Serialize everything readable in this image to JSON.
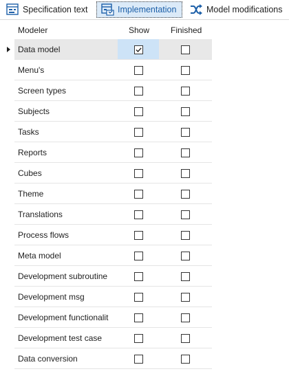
{
  "tabs": [
    {
      "label": "Specification text",
      "icon": "spec-text-icon",
      "active": false
    },
    {
      "label": "Implementation",
      "icon": "implementation-icon",
      "active": true
    },
    {
      "label": "Model modifications",
      "icon": "shuffle-icon",
      "active": false
    }
  ],
  "columns": {
    "modeler": "Modeler",
    "show": "Show",
    "finished": "Finished"
  },
  "colors": {
    "accent": "#1c5fa8",
    "selected_cell": "#cde3f7",
    "selected_row": "#e8e8e8"
  },
  "rows": [
    {
      "name": "Data model",
      "show": true,
      "finished": false,
      "selected": true
    },
    {
      "name": "Menu's",
      "show": false,
      "finished": false,
      "selected": false
    },
    {
      "name": "Screen types",
      "show": false,
      "finished": false,
      "selected": false
    },
    {
      "name": "Subjects",
      "show": false,
      "finished": false,
      "selected": false
    },
    {
      "name": "Tasks",
      "show": false,
      "finished": false,
      "selected": false
    },
    {
      "name": "Reports",
      "show": false,
      "finished": false,
      "selected": false
    },
    {
      "name": "Cubes",
      "show": false,
      "finished": false,
      "selected": false
    },
    {
      "name": "Theme",
      "show": false,
      "finished": false,
      "selected": false
    },
    {
      "name": "Translations",
      "show": false,
      "finished": false,
      "selected": false
    },
    {
      "name": "Process flows",
      "show": false,
      "finished": false,
      "selected": false
    },
    {
      "name": "Meta model",
      "show": false,
      "finished": false,
      "selected": false
    },
    {
      "name": "Development subroutine",
      "show": false,
      "finished": false,
      "selected": false
    },
    {
      "name": "Development msg",
      "show": false,
      "finished": false,
      "selected": false
    },
    {
      "name": "Development functionalit",
      "show": false,
      "finished": false,
      "selected": false
    },
    {
      "name": "Development test case",
      "show": false,
      "finished": false,
      "selected": false
    },
    {
      "name": "Data conversion",
      "show": false,
      "finished": false,
      "selected": false
    }
  ]
}
